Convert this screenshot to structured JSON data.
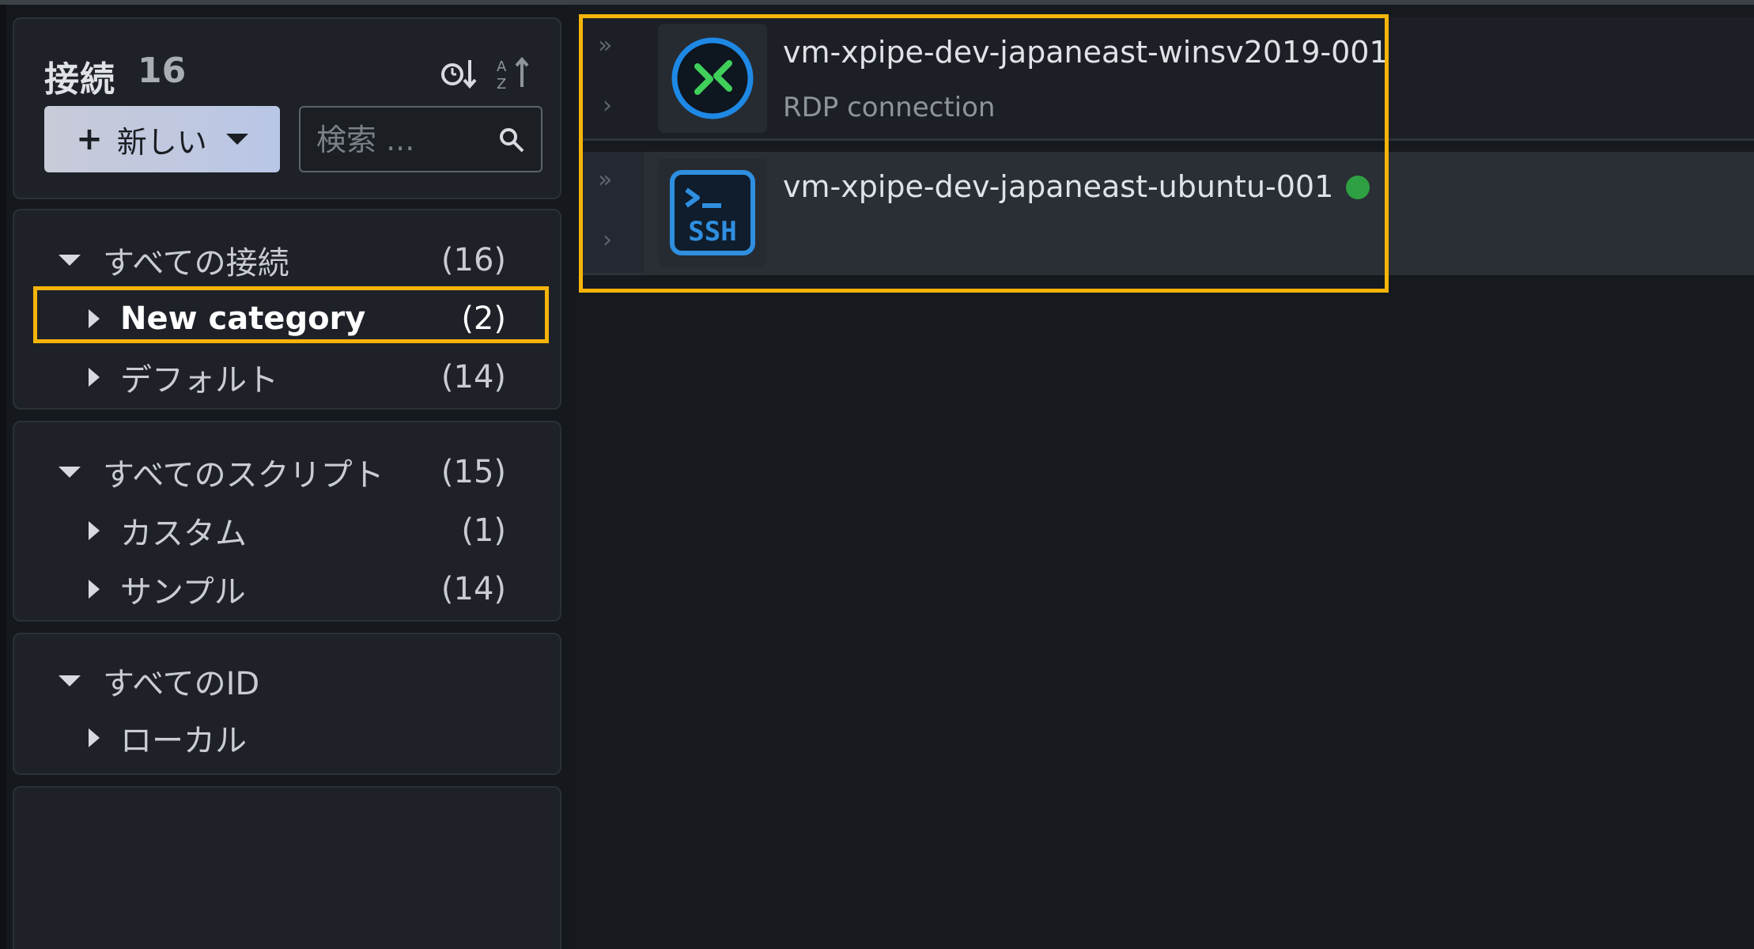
{
  "sidebar": {
    "header": {
      "title": "接続",
      "count": "16",
      "new_button_label": "新しい",
      "search_placeholder": "検索 ...",
      "icons": [
        "sort-by-time-icon",
        "sort-alphabetical-icon",
        "plus-icon",
        "caret-down-icon",
        "search-icon"
      ]
    },
    "connections": {
      "label": "すべての接続",
      "count": "(16)",
      "children": [
        {
          "label": "New category",
          "count": "(2)",
          "selected": true
        },
        {
          "label": "デフォルト",
          "count": "(14)"
        }
      ]
    },
    "scripts": {
      "label": "すべてのスクリプト",
      "count": "(15)",
      "children": [
        {
          "label": "カスタム",
          "count": "(1)"
        },
        {
          "label": "サンプル",
          "count": "(14)"
        }
      ]
    },
    "identities": {
      "label": "すべてのID",
      "children": [
        {
          "label": "ローカル"
        }
      ]
    }
  },
  "main": {
    "connections": [
      {
        "name": "vm-xpipe-dev-japaneast-winsv2019-001",
        "subtitle": "RDP connection",
        "icon": "rdp-icon"
      },
      {
        "name": "vm-xpipe-dev-japaneast-ubuntu-001",
        "subtitle": "",
        "icon": "ssh-icon",
        "status": "online"
      }
    ]
  },
  "colors": {
    "highlight": "#f5b40a",
    "status_online": "#2ea043",
    "rdp_ring": "#1e88e5",
    "rdp_arrows": "#3fcf5a",
    "ssh_blue": "#2f8fe0"
  }
}
